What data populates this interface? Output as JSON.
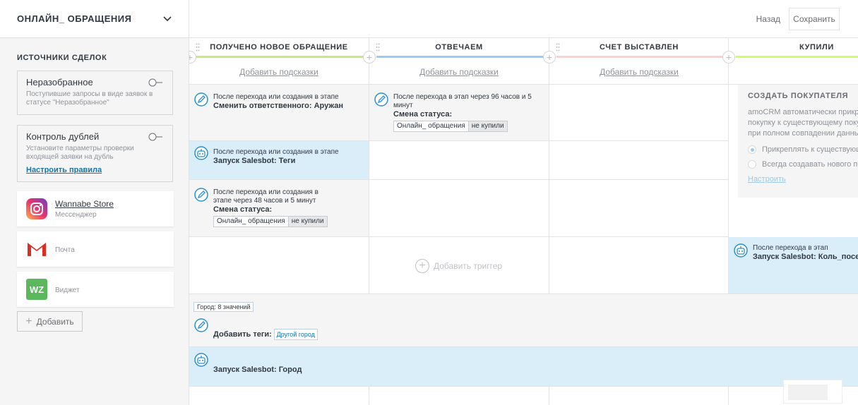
{
  "header": {
    "pipeline_name": "ОНЛАЙН_ ОБРАЩЕНИЯ",
    "back_label": "Назад",
    "save_label": "Сохранить"
  },
  "sidebar": {
    "sources_title": "ИСТОЧНИКИ СДЕЛОК",
    "unsorted": {
      "title": "Неразобранное",
      "desc": "Поступившие запросы в виде заявок в статусе \"Неразобранное\""
    },
    "duplicates": {
      "title": "Контроль дублей",
      "desc": "Установите параметры проверки входящей заявки на дубль",
      "link": "Настроить правила"
    },
    "sources": [
      {
        "name": "Wannabe Store",
        "type": "Мессенджер",
        "icon": "instagram-icon"
      },
      {
        "name": "",
        "type": "Почта",
        "icon": "gmail-icon"
      },
      {
        "name": "",
        "type": "Виджет",
        "icon": "wz-widget-icon",
        "badge": "WZ"
      }
    ],
    "add_label": "Добавить"
  },
  "stages": [
    {
      "name": "ПОЛУЧЕНО НОВОЕ ОБРАЩЕНИЕ",
      "color": "#c8ea7a",
      "hint": "Добавить подсказки"
    },
    {
      "name": "ОТВЕЧАЕМ",
      "color": "#99ccfd",
      "hint": "Добавить подсказки"
    },
    {
      "name": "СЧЕТ ВЫСТАВЛЕН",
      "color": "#fdcfcf",
      "hint": "Добавить подсказки"
    },
    {
      "name": "КУПИЛИ",
      "color": "#ccff66",
      "hint": ""
    }
  ],
  "triggers": {
    "s1_t1": {
      "when": "После перехода или создания в этапе",
      "action": "Сменить ответственного: Аружан"
    },
    "s1_t2": {
      "when": "После перехода или создания в этапе",
      "action": "Запуск Salesbot: Теги"
    },
    "s1_t3": {
      "when": "После перехода или создания в этапе через 48 часов и 5 минут",
      "action": "Смена статуса:",
      "pipeline": "Онлайн_ обращения",
      "status": "не купили"
    },
    "s2_t1": {
      "when": "После перехода в этап через 96 часов и 5 минут",
      "action": "Смена статуса:",
      "pipeline": "Онлайн_ обращения",
      "status": "не купили"
    },
    "s4_t1": {
      "when": "После перехода в этап",
      "action": "Запуск Salesbot: Коль_посещ"
    },
    "add_trigger": "Добавить триггер",
    "city_filter": "Город: 8 значений",
    "tags_label": "Добавить теги:",
    "tag_value": "Другой город",
    "salesbot_city": "Запуск Salesbot: Город"
  },
  "buyer": {
    "title": "СОЗДАТЬ ПОКУПАТЕЛЯ",
    "desc_line1": "amoCRM автоматически прикр",
    "desc_line2": "покупку к существующему поку",
    "desc_line3": "при полном совпадении данны",
    "option1": "Прикреплять к существующ",
    "option2": "Всегда создавать нового по",
    "link": "Настроить"
  },
  "colors": {
    "blue_cell": "#d9eef9",
    "grey_cell": "#f5f5f5",
    "link": "#1375ab"
  }
}
